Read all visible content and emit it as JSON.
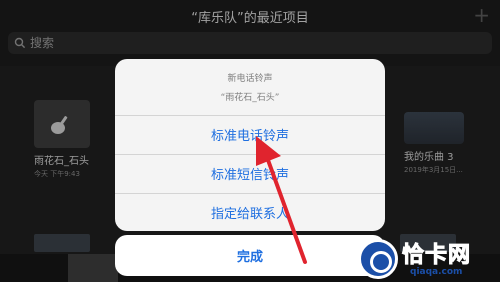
{
  "header": {
    "title": "“库乐队”的最近项目",
    "add_icon": "+"
  },
  "search": {
    "placeholder": "搜索"
  },
  "songs": [
    {
      "name": "雨花石_石头",
      "date": "今天 下午9:43"
    },
    {
      "name": "我的乐曲 3",
      "date": "2019年3月15日..."
    }
  ],
  "sheet": {
    "title": "新电话铃声",
    "subtitle": "“雨花石_石头”",
    "options": [
      "标准电话铃声",
      "标准短信铃声",
      "指定给联系人"
    ],
    "done": "完成"
  },
  "watermark": {
    "name": "恰卡网",
    "url": "qiaqa.com"
  },
  "colors": {
    "accent": "#1f6fe0",
    "arrow": "#e0242e"
  }
}
